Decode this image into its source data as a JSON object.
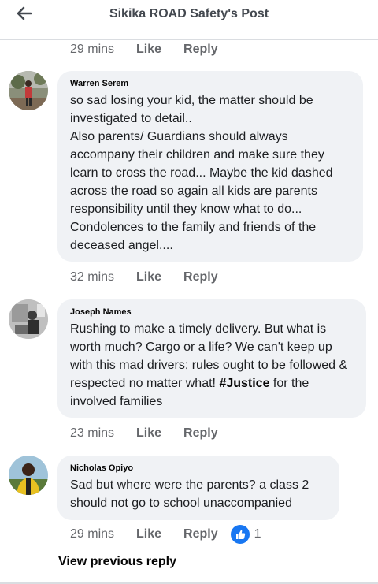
{
  "header": {
    "title": "Sikika ROAD Safety's Post",
    "back_icon": "back-arrow-icon"
  },
  "actions": {
    "like": "Like",
    "reply": "Reply"
  },
  "top_meta": {
    "time": "29 mins"
  },
  "comments": [
    {
      "author": "Warren Serem",
      "text": "so sad losing your kid, the matter should be investigated to detail..\nAlso parents/ Guardians should always accompany their children and make sure they learn to cross the road... Maybe the kid dashed across the road so again all kids are parents responsibility until they know what to do... Condolences to the family and friends of the deceased angel....",
      "time": "32 mins"
    },
    {
      "author": "Joseph Names",
      "text_before": "Rushing to make a timely delivery. But what is worth much? Cargo or a life? We can't keep up with this mad drivers; rules ought to be followed & respected no matter what! ",
      "hashtag": "#Justice",
      "text_after": " for the involved families",
      "time": "23 mins"
    },
    {
      "author": "Nicholas Opiyo",
      "text": "Sad but where  were the parents? a class 2 should not go to school unaccompanied",
      "time": "29 mins",
      "reaction_count": "1",
      "reaction_icon": "like-thumb-icon"
    }
  ],
  "view_previous": "View previous reply",
  "colors": {
    "bubble": "#f0f2f5",
    "meta": "#65676b",
    "like_blue": "#1877f2"
  }
}
